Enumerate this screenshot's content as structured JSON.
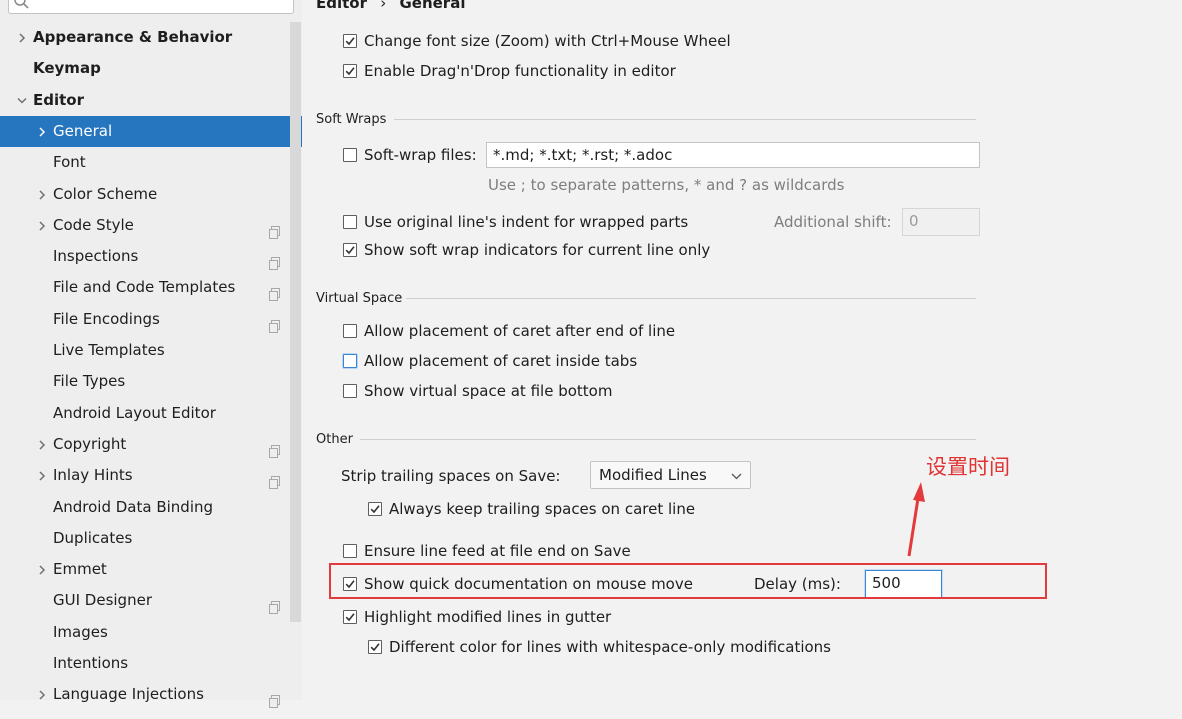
{
  "breadcrumb": {
    "parent": "Editor",
    "sep": "›",
    "current": "General"
  },
  "sidebar": {
    "search_placeholder": "",
    "items": [
      {
        "label": "Appearance & Behavior",
        "bold": true,
        "arrow": "right"
      },
      {
        "label": "Keymap",
        "bold": true,
        "arrow": "none"
      },
      {
        "label": "Editor",
        "bold": true,
        "arrow": "down"
      },
      {
        "label": "General",
        "arrow": "right",
        "selected": true
      },
      {
        "label": "Font",
        "arrow": "none"
      },
      {
        "label": "Color Scheme",
        "arrow": "right"
      },
      {
        "label": "Code Style",
        "arrow": "right",
        "project": true
      },
      {
        "label": "Inspections",
        "arrow": "none",
        "project": true
      },
      {
        "label": "File and Code Templates",
        "arrow": "none",
        "project": true
      },
      {
        "label": "File Encodings",
        "arrow": "none",
        "project": true
      },
      {
        "label": "Live Templates",
        "arrow": "none"
      },
      {
        "label": "File Types",
        "arrow": "none"
      },
      {
        "label": "Android Layout Editor",
        "arrow": "none"
      },
      {
        "label": "Copyright",
        "arrow": "right",
        "project": true
      },
      {
        "label": "Inlay Hints",
        "arrow": "right",
        "project": true
      },
      {
        "label": "Android Data Binding",
        "arrow": "none"
      },
      {
        "label": "Duplicates",
        "arrow": "none"
      },
      {
        "label": "Emmet",
        "arrow": "right"
      },
      {
        "label": "GUI Designer",
        "arrow": "none",
        "project": true
      },
      {
        "label": "Images",
        "arrow": "none"
      },
      {
        "label": "Intentions",
        "arrow": "none"
      },
      {
        "label": "Language Injections",
        "arrow": "right",
        "project": true
      }
    ]
  },
  "general": {
    "zoom": {
      "label": "Change font size (Zoom) with Ctrl+Mouse Wheel",
      "checked": true
    },
    "dnd": {
      "label": "Enable Drag'n'Drop functionality in editor",
      "checked": true
    }
  },
  "soft_wraps": {
    "title": "Soft Wraps",
    "files": {
      "label": "Soft-wrap files:",
      "checked": false,
      "value": "*.md; *.txt; *.rst; *.adoc"
    },
    "hint": "Use ; to separate patterns, * and ? as wildcards",
    "indent": {
      "label": "Use original line's indent for wrapped parts",
      "checked": false
    },
    "additional_shift": {
      "label": "Additional shift:",
      "value": "0"
    },
    "indicators": {
      "label": "Show soft wrap indicators for current line only",
      "checked": true
    }
  },
  "virtual_space": {
    "title": "Virtual Space",
    "after_end": {
      "label": "Allow placement of caret after end of line",
      "checked": false
    },
    "inside_tabs": {
      "label": "Allow placement of caret inside tabs",
      "checked": false
    },
    "file_bottom": {
      "label": "Show virtual space at file bottom",
      "checked": false
    }
  },
  "other": {
    "title": "Other",
    "strip": {
      "label": "Strip trailing spaces on Save:",
      "value": "Modified Lines"
    },
    "keep_trailing": {
      "label": "Always keep trailing spaces on caret line",
      "checked": true
    },
    "line_feed": {
      "label": "Ensure line feed at file end on Save",
      "checked": false
    },
    "quick_doc": {
      "label": "Show quick documentation on mouse move",
      "checked": true
    },
    "delay": {
      "label": "Delay (ms):",
      "value": "500"
    },
    "highlight": {
      "label": "Highlight modified lines in gutter",
      "checked": true
    },
    "whitespace": {
      "label": "Different color for lines with whitespace-only modifications",
      "checked": true
    }
  },
  "annotation": {
    "text": "设置时间",
    "color": "#e33b3b"
  },
  "colors": {
    "selection": "#2675bf",
    "focus": "#3a86d4"
  }
}
